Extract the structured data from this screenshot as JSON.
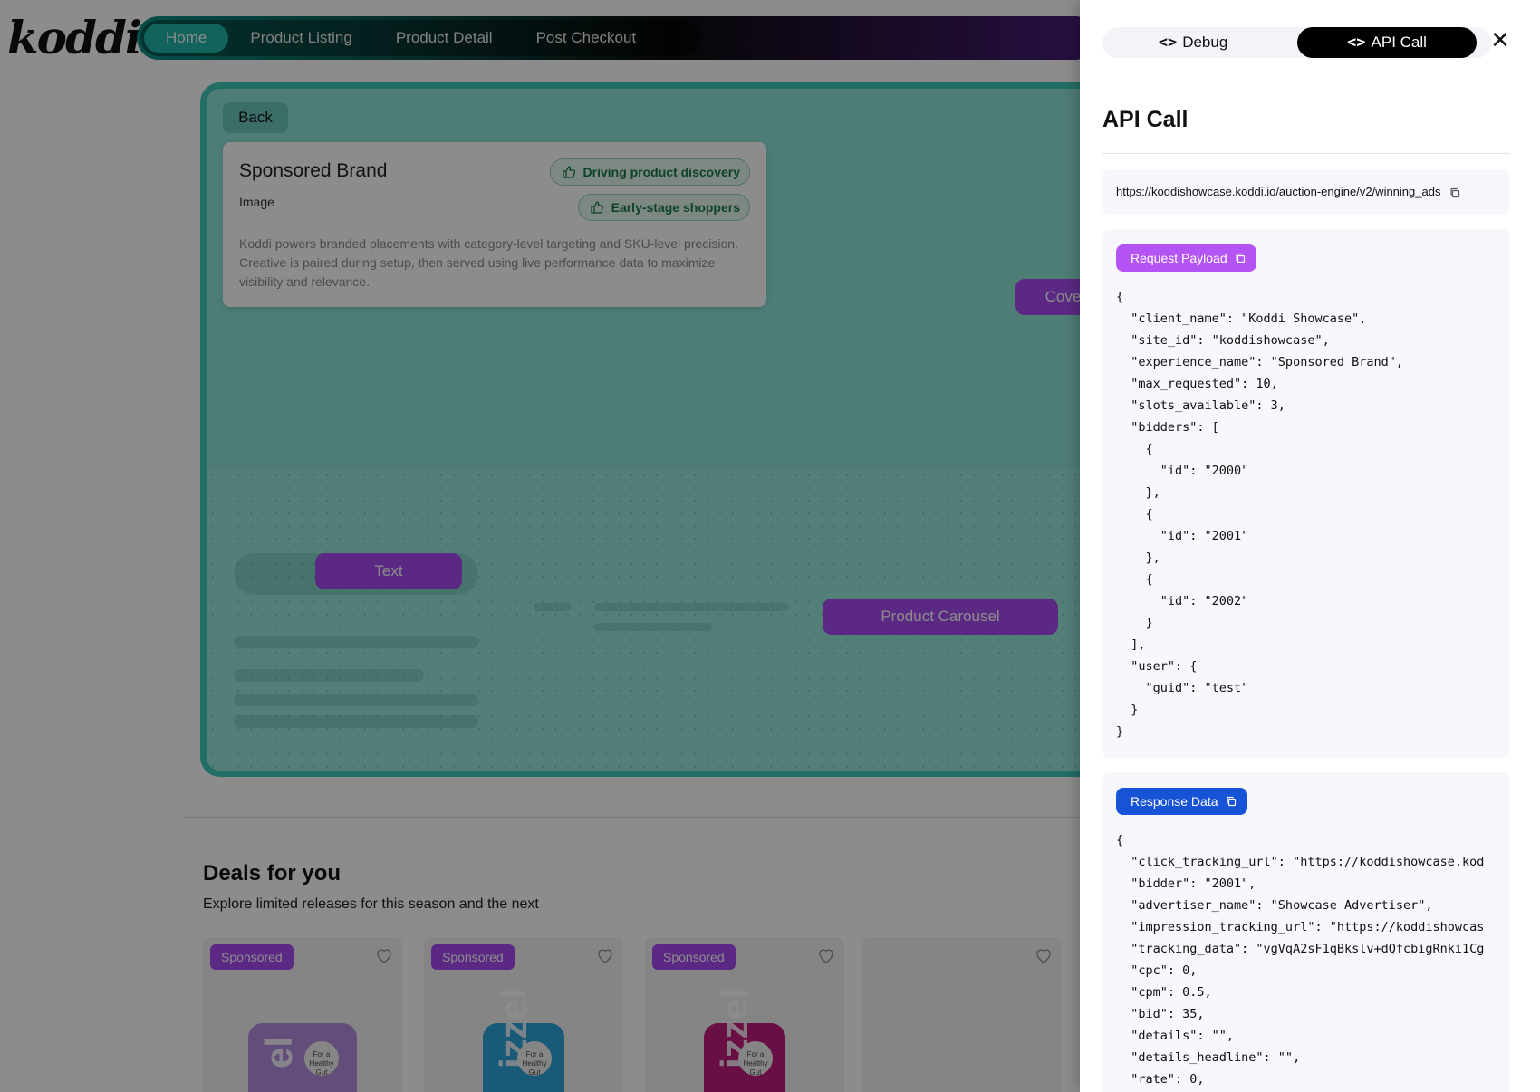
{
  "brand": {
    "logo": "koddi"
  },
  "nav": {
    "items": [
      {
        "label": "Home",
        "active": true
      },
      {
        "label": "Product Listing",
        "active": false
      },
      {
        "label": "Product Detail",
        "active": false
      },
      {
        "label": "Post Checkout",
        "active": false
      }
    ]
  },
  "hero": {
    "back_label": "Back",
    "card": {
      "title": "Sponsored Brand",
      "subtitle": "Image",
      "description": "Koddi powers branded placements with category-level targeting and SKU-level precision. Creative is paired during setup, then served using live performance data to maximize visibility and relevance.",
      "tags": [
        "Driving product discovery",
        "Early-stage shoppers"
      ]
    },
    "placements": {
      "cover": "Cover I",
      "text": "Text",
      "carousel": "Product Carousel"
    }
  },
  "deals": {
    "title": "Deals for you",
    "subtitle": "Explore limited releases for this season and the next",
    "products": [
      {
        "badge": "Sponsored",
        "can_text": "el",
        "can_color": "#b58ee0",
        "dot_text": "For a Healthy Gut"
      },
      {
        "badge": "Sponsored",
        "can_text": "izzel",
        "can_color": "#2ea5dc",
        "dot_text": "For a Healthy Gut"
      },
      {
        "badge": "Sponsored",
        "can_text": "izzel",
        "can_color": "#c01c7a",
        "dot_text": "For a Healthy Gut"
      },
      {
        "badge": "",
        "can_text": "",
        "can_color": "",
        "dot_text": ""
      }
    ]
  },
  "panel": {
    "tabs": {
      "debug": "Debug",
      "api": "API Call"
    },
    "title": "API Call",
    "url": "https://koddishowcase.koddi.io/auction-engine/v2/winning_ads",
    "request_label": "Request Payload",
    "request_code": "{\n  \"client_name\": \"Koddi Showcase\",\n  \"site_id\": \"koddishowcase\",\n  \"experience_name\": \"Sponsored Brand\",\n  \"max_requested\": 10,\n  \"slots_available\": 3,\n  \"bidders\": [\n    {\n      \"id\": \"2000\"\n    },\n    {\n      \"id\": \"2001\"\n    },\n    {\n      \"id\": \"2002\"\n    }\n  ],\n  \"user\": {\n    \"guid\": \"test\"\n  }\n}",
    "response_label": "Response Data",
    "response_code": "{\n  \"click_tracking_url\": \"https://koddishowcase.kod\n  \"bidder\": \"2001\",\n  \"advertiser_name\": \"Showcase Advertiser\",\n  \"impression_tracking_url\": \"https://koddishowcas\n  \"tracking_data\": \"vgVqA2sF1qBkslv+dQfcbigRnki1Cg\n  \"cpc\": 0,\n  \"cpm\": 0.5,\n  \"bid\": 35,\n  \"details\": \"\",\n  \"details_headline\": \"\",\n  \"rate\": 0,"
  },
  "colors": {
    "accent_teal": "#1fb4a8",
    "accent_purple": "#a64cf0",
    "response_blue": "#1753d6"
  }
}
